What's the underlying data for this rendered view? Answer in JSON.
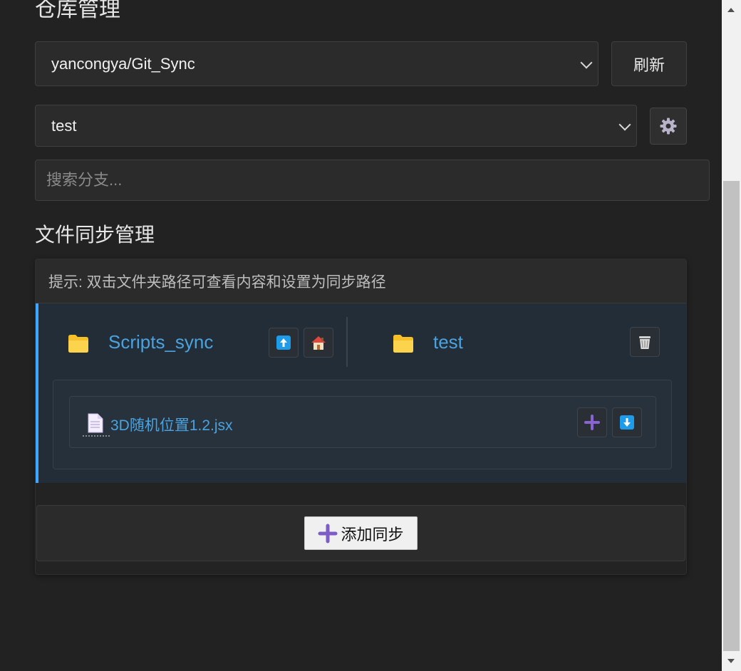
{
  "repo_section": {
    "title": "仓库管理",
    "repo_select_value": "yancongya/Git_Sync",
    "refresh_label": "刷新",
    "branch_select_value": "test",
    "branch_search_placeholder": "搜索分支..."
  },
  "sync_section": {
    "title": "文件同步管理",
    "tip": "提示: 双击文件夹路径可查看内容和设置为同步路径",
    "pairs": [
      {
        "local_path": "Scripts_sync",
        "remote_path": "test",
        "files": [
          {
            "name": "3D随机位置1.2.jsx"
          }
        ]
      }
    ],
    "add_button_label": "添加同步"
  },
  "colors": {
    "background": "#222222",
    "accent": "#3ea6ff",
    "link": "#4aa3df",
    "plus": "#7d5cc8"
  }
}
